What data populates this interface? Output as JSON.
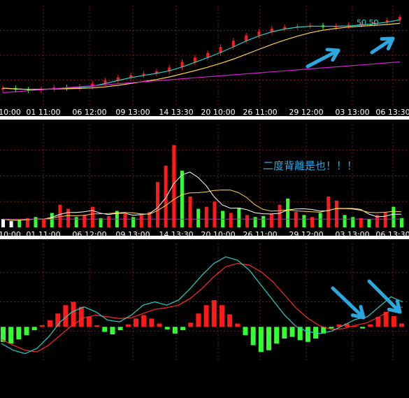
{
  "colors": {
    "background": "#000000",
    "separator": "#ffffff",
    "grid": "#7a1a1a",
    "up": "#ff1a1a",
    "down": "#33ff33",
    "neutral": "#ffffff",
    "ma_short": "#25d0c8",
    "ma_mid": "#ffd24a",
    "ma_long": "#d020d0",
    "dif": "#25d0c8",
    "dea": "#ff2b2b",
    "annotation": "#2aa8e0"
  },
  "icons": [
    "arrow-up-right-icon",
    "arrow-down-right-icon"
  ],
  "annotations": {
    "price_label": "50.50",
    "divergence_text": "二度背離是也！！！"
  },
  "chart_data": [
    {
      "type": "candlestick",
      "panel": "price",
      "x_tick_labels": [
        "10:00",
        "01 11:00",
        "06 12:00",
        "09 13:00",
        "14 13:30",
        "20 10:00",
        "26 11:00",
        "29 12:00",
        "03 13:00",
        "06 13:30"
      ],
      "close": [
        41.2,
        41.0,
        40.9,
        41.1,
        41.3,
        41.2,
        41.4,
        41.8,
        42.2,
        42.6,
        42.9,
        43.1,
        43.4,
        43.9,
        44.6,
        45.2,
        45.8,
        46.6,
        47.4,
        48.1,
        48.6,
        49.0,
        49.2,
        49.3,
        49.4,
        49.2,
        49.3,
        49.5,
        49.6,
        49.8,
        50.1,
        50.5
      ],
      "ylim": [
        39,
        52
      ],
      "moving_averages": [
        "short",
        "mid",
        "long"
      ]
    },
    {
      "type": "bar",
      "panel": "volume",
      "x_tick_labels": [
        "10:00",
        "01 11:00",
        "06 12:00",
        "09 13:00",
        "14 13:30",
        "20 10:00",
        "26 11:00",
        "29 12:00",
        "03 13:00",
        "06 13:30"
      ],
      "values": [
        8,
        6,
        7,
        9,
        10,
        8,
        14,
        22,
        18,
        10,
        12,
        20,
        9,
        11,
        16,
        13,
        10,
        12,
        15,
        44,
        60,
        80,
        55,
        30,
        18,
        20,
        25,
        16,
        14,
        19,
        12,
        10,
        11,
        13,
        22,
        28,
        15,
        12,
        10,
        14,
        30,
        26,
        12,
        10,
        9,
        8,
        12,
        15,
        20,
        9
      ],
      "colors": [
        "w",
        "w",
        "g",
        "r",
        "g",
        "r",
        "g",
        "r",
        "r",
        "g",
        "r",
        "r",
        "g",
        "r",
        "g",
        "r",
        "g",
        "r",
        "r",
        "r",
        "r",
        "r",
        "g",
        "r",
        "g",
        "r",
        "r",
        "g",
        "r",
        "g",
        "r",
        "g",
        "g",
        "r",
        "r",
        "g",
        "r",
        "g",
        "r",
        "g",
        "r",
        "r",
        "g",
        "g",
        "r",
        "g",
        "r",
        "r",
        "g",
        "g"
      ],
      "ylim": [
        0,
        100
      ]
    },
    {
      "type": "macd",
      "panel": "macd",
      "x_tick_labels": [],
      "histogram": [
        -1.8,
        -2.0,
        -1.5,
        -1.0,
        -0.4,
        0.2,
        0.8,
        1.6,
        2.6,
        3.0,
        2.4,
        1.2,
        0.2,
        -0.6,
        -0.9,
        -0.4,
        0.3,
        1.0,
        1.4,
        1.0,
        0.4,
        -0.3,
        -0.8,
        -0.4,
        0.5,
        1.6,
        2.6,
        3.2,
        2.6,
        1.5,
        0.4,
        -1.0,
        -2.2,
        -3.0,
        -2.8,
        -2.0,
        -1.4,
        -1.2,
        -1.6,
        -1.8,
        -1.4,
        -0.8,
        -0.2,
        0.3,
        0.4,
        0.1,
        -0.2,
        0.3,
        1.2,
        1.8,
        1.3,
        0.4
      ],
      "dif": [
        -2.0,
        -2.8,
        -3.2,
        -2.6,
        -1.2,
        0.6,
        1.8,
        2.4,
        1.8,
        0.8,
        0.6,
        1.4,
        2.6,
        3.0,
        2.6,
        3.2,
        4.6,
        6.2,
        7.6,
        8.4,
        8.0,
        6.8,
        5.0,
        3.2,
        1.4,
        0.0,
        -0.6,
        -0.8,
        -0.5,
        0.2,
        0.9,
        1.2,
        2.4,
        3.6,
        3.0
      ],
      "dea": [
        -1.5,
        -2.2,
        -2.8,
        -3.0,
        -2.2,
        -1.0,
        0.2,
        1.1,
        1.4,
        1.2,
        1.0,
        1.1,
        1.6,
        2.1,
        2.3,
        2.6,
        3.4,
        4.6,
        6.0,
        7.2,
        7.6,
        7.4,
        6.6,
        5.4,
        3.8,
        2.2,
        1.0,
        0.1,
        -0.3,
        -0.2,
        0.2,
        0.5,
        1.2,
        2.0,
        2.4
      ],
      "ylim": [
        -4,
        10
      ]
    }
  ]
}
